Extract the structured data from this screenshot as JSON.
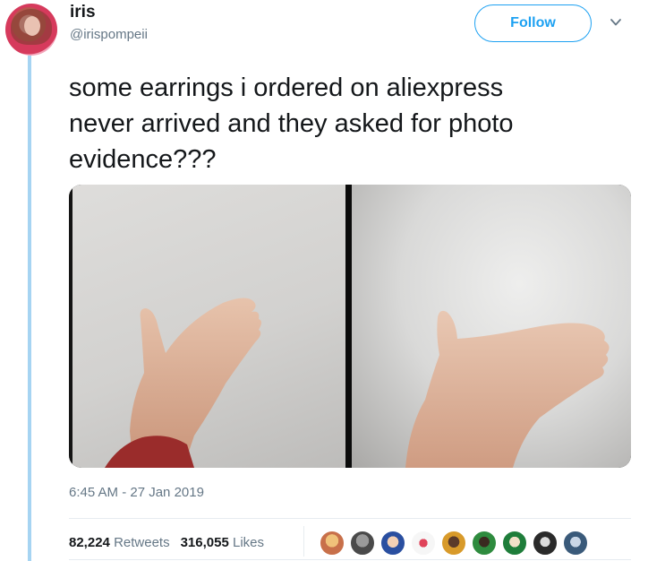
{
  "author": {
    "name": "iris",
    "handle": "@irispompeii"
  },
  "actions": {
    "follow_label": "Follow"
  },
  "tweet": {
    "text_line1": "some earrings i ordered on aliexpress",
    "text_line2": "never arrived and they asked for photo",
    "text_line3": "evidence???",
    "timestamp": "6:45 AM - 27 Jan 2019"
  },
  "stats": {
    "retweets_count": "82,224",
    "retweets_label": "Retweets",
    "likes_count": "316,055",
    "likes_label": "Likes"
  },
  "colors": {
    "accent": "#1da1f2",
    "thread_line": "#a6d4f2",
    "muted_text": "#657786"
  },
  "icons": {
    "more": "chevron-down-icon"
  }
}
